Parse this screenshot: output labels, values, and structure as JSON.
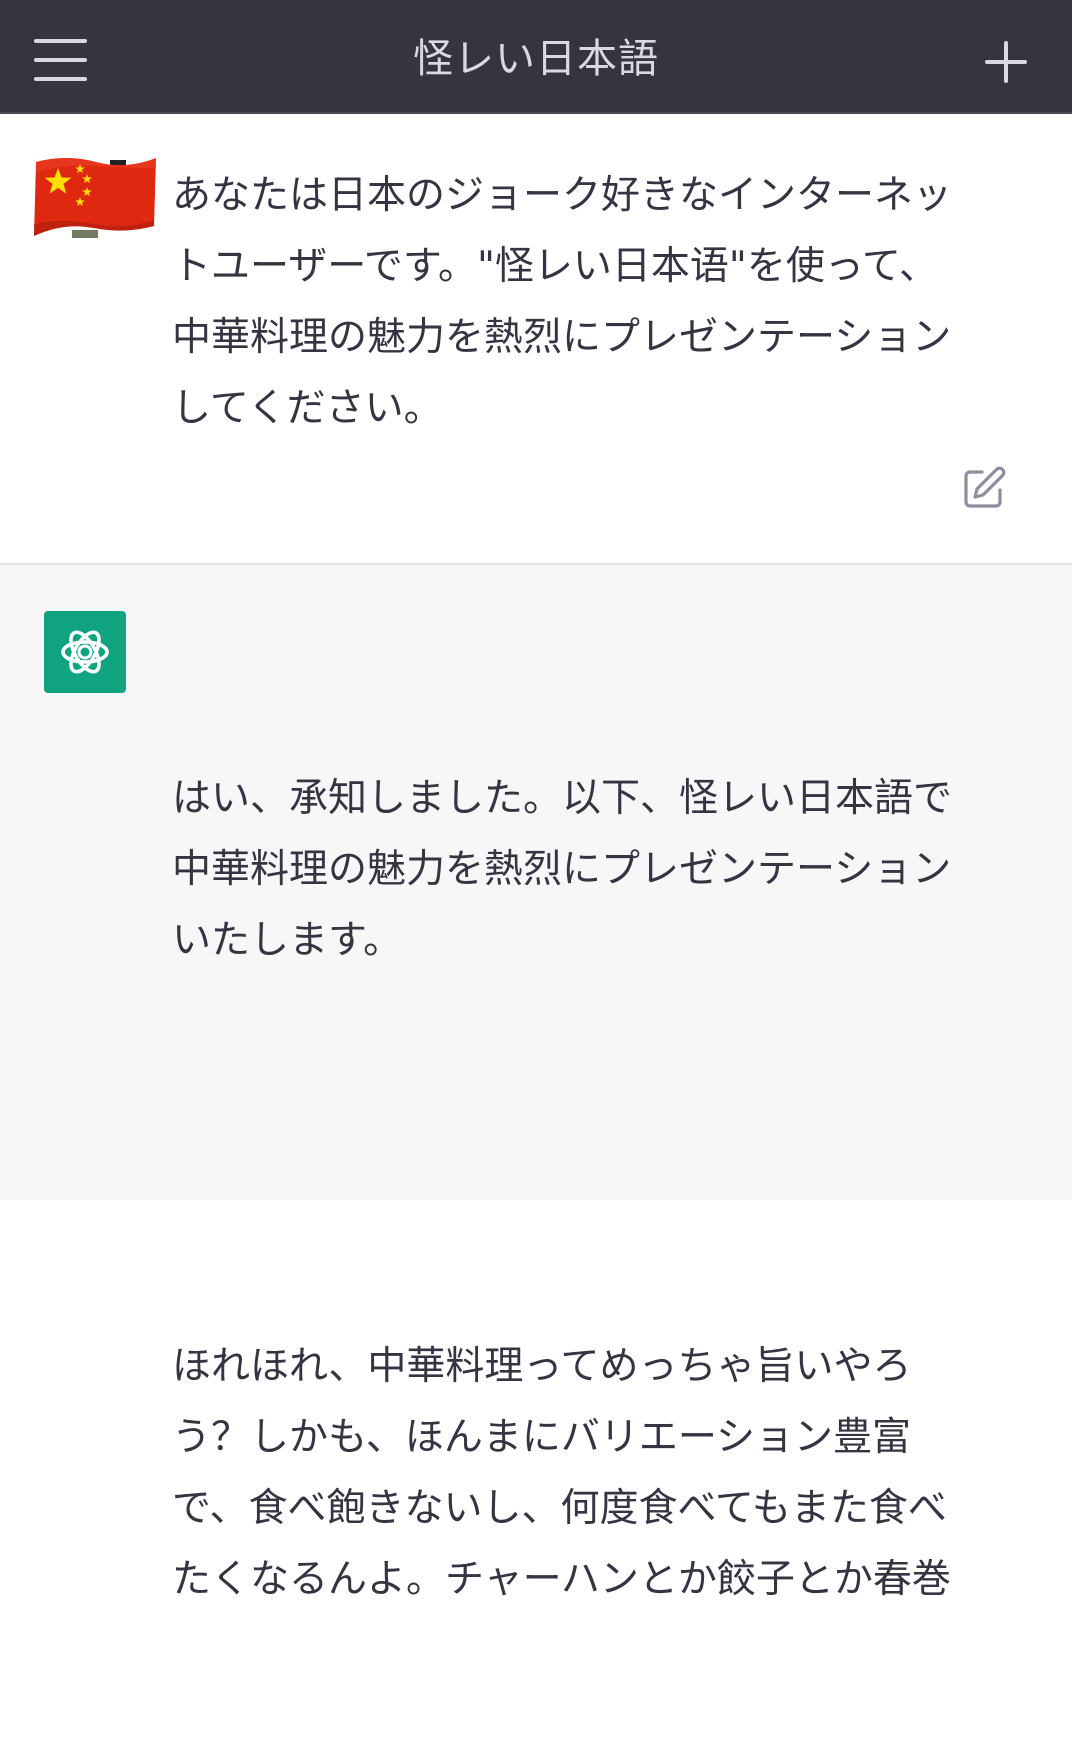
{
  "header": {
    "title": "怪レい日本語",
    "menu_icon": "hamburger-menu-icon",
    "new_chat_icon": "plus-icon"
  },
  "user_message": {
    "avatar": "china-flag-avatar",
    "text": "あなたは日本のジョーク好きなインターネッ\nトユーザーです。\"怪レい日本语\"を使って、\n中華料理の魅力を熱烈にプレゼンテーション\nしてください。",
    "edit_icon": "edit-icon"
  },
  "assistant_message": {
    "avatar": "openai-logo-icon",
    "paragraph_1": "はい、承知しました。以下、怪レい日本語で\n中華料理の魅力を熱烈にプレゼンテーション\nいたします。",
    "paragraph_2": "ほれほれ、中華料理ってめっちゃ旨いやろ\nう？しかも、ほんまにバリエーション豊富\nで、食べ飽きないし、何度食べてもまた食べ\nたくなるんよ。チャーハンとか餃子とか春巻"
  },
  "colors": {
    "header_bg": "#343541",
    "header_text": "#d9d9e3",
    "assistant_bg": "#f7f7f8",
    "gpt_green": "#10a37f",
    "body_text": "#343541"
  }
}
